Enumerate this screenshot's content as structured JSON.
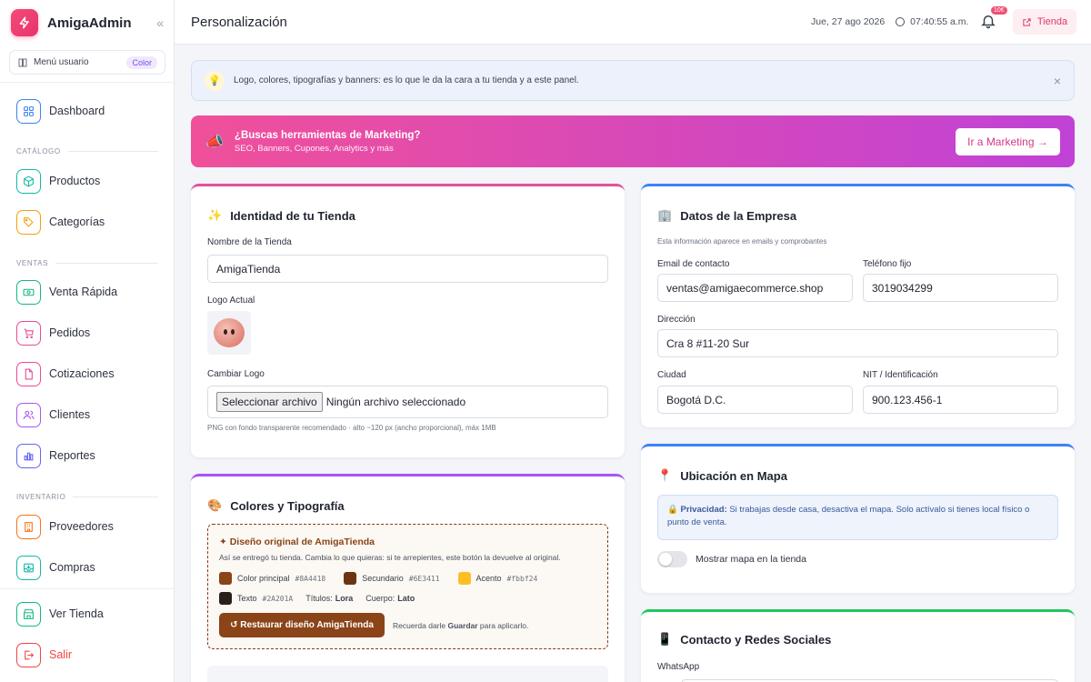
{
  "sidebar": {
    "brand": "AmigaAdmin",
    "menu_user": {
      "label": "Menú usuario",
      "badge": "Color"
    },
    "items": [
      {
        "label": "Dashboard"
      },
      {
        "section": "CATÁLOGO"
      },
      {
        "label": "Productos"
      },
      {
        "label": "Categorías"
      },
      {
        "section": "VENTAS"
      },
      {
        "label": "Venta Rápida"
      },
      {
        "label": "Pedidos"
      },
      {
        "label": "Cotizaciones"
      },
      {
        "label": "Clientes"
      },
      {
        "label": "Reportes"
      },
      {
        "section": "INVENTARIO"
      },
      {
        "label": "Proveedores"
      },
      {
        "label": "Compras"
      },
      {
        "label": "Ver Tienda"
      },
      {
        "label": "Salir"
      }
    ]
  },
  "header": {
    "title": "Personalización",
    "date": "Jue, 27 ago 2026",
    "time": "07:40:55 a.m.",
    "notif_count": "10€",
    "store_btn": "Tienda"
  },
  "alert": {
    "text": "Logo, colores, tipografías y banners: es lo que le da la cara a tu tienda y a este panel.",
    "close": "×"
  },
  "banner": {
    "title": "¿Buscas herramientas de Marketing?",
    "subtitle": "SEO, Banners, Cupones, Analytics y más",
    "cta": "Ir a Marketing →"
  },
  "identity": {
    "title": "Identidad de tu Tienda",
    "store_name_label": "Nombre de la Tienda",
    "store_name": "AmigaTienda",
    "logo_label": "Logo Actual",
    "change_logo_label": "Cambiar Logo",
    "file_btn": "Seleccionar archivo",
    "file_status": "Ningún archivo seleccionado",
    "hint": "PNG con fondo transparente recomendado · alto ~120 px (ancho proporcional), máx 1MB"
  },
  "colors": {
    "title": "Colores y Tipografía",
    "original_title": "✦ Diseño original de AmigaTienda",
    "original_sub": "Así se entregó tu tienda. Cambia lo que quieras: si te arrepientes, este botón la devuelve al original.",
    "primary_label": "Color principal",
    "primary_code": "#8A4418",
    "primary_color": "#8A4418",
    "secondary_label": "Secundario",
    "secondary_code": "#6E3411",
    "secondary_color": "#6E3411",
    "accent_label": "Acento",
    "accent_code": "#fbbf24",
    "accent_color": "#fbbf24",
    "text_label": "Texto",
    "text_code": "#2A201A",
    "text_color": "#2A201A",
    "titles_label": "Títulos:",
    "titles_font": "Lora",
    "body_label": "Cuerpo:",
    "body_font": "Lato",
    "restore_btn": "↺ Restaurar diseño AmigaTienda",
    "restore_note_pre": "Recuerda darle ",
    "restore_note_bold": "Guardar",
    "restore_note_post": " para aplicarlo."
  },
  "company": {
    "title": "Datos de la Empresa",
    "subtitle": "Esta información aparece en emails y comprobantes",
    "email_label": "Email de contacto",
    "email": "ventas@amigaecommerce.shop",
    "phone_label": "Teléfono fijo",
    "phone": "3019034299",
    "address_label": "Dirección",
    "address": "Cra 8 #11-20 Sur",
    "city_label": "Ciudad",
    "city": "Bogotá D.C.",
    "nit_label": "NIT / Identificación",
    "nit": "900.123.456-1"
  },
  "map": {
    "title": "Ubicación en Mapa",
    "privacy_bold": "Privacidad:",
    "privacy_text": " Si trabajas desde casa, desactiva el mapa. Solo actívalo si tienes local físico o punto de venta.",
    "toggle_label": "Mostrar mapa en la tienda"
  },
  "social": {
    "title": "Contacto y Redes Sociales",
    "whatsapp_label": "WhatsApp"
  },
  "theme": {
    "accent": "#e2376b",
    "identity_border": "#e0529b",
    "colors_border": "#a855f7",
    "company_border": "#3b82f6",
    "map_border": "#3b82f6",
    "social_border": "#22c55e"
  }
}
